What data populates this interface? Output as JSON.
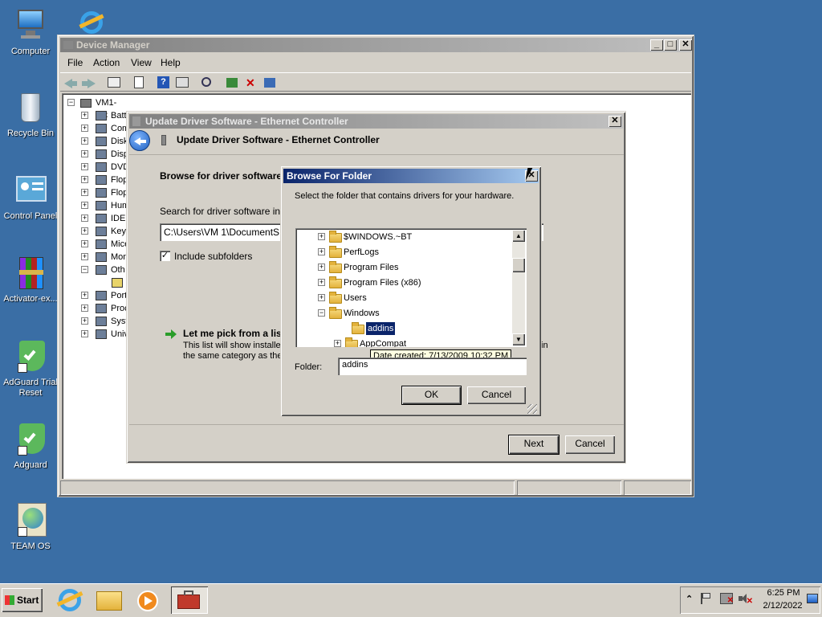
{
  "desktop": {
    "icons": [
      {
        "label": "Computer"
      },
      {
        "label": "Recycle Bin"
      },
      {
        "label": "Control Panel"
      },
      {
        "label": "Activator-ex..."
      },
      {
        "label": "AdGuard Trial Reset"
      },
      {
        "label": "Adguard"
      },
      {
        "label": "TEAM OS"
      }
    ]
  },
  "device_manager": {
    "title": "Device Manager",
    "menu": [
      "File",
      "Action",
      "View",
      "Help"
    ],
    "tree_root": "VM1-PC",
    "tree_items": [
      "Batt",
      "Com",
      "Disk",
      "Disp",
      "DVD",
      "Flop",
      "Flop",
      "Hum",
      "IDE",
      "Key",
      "Mice",
      "Mon",
      "Oth",
      "",
      "Port",
      "Proc",
      "Syst",
      "Univ"
    ]
  },
  "update_driver": {
    "title": "Update Driver Software - Ethernet Controller",
    "header": "Update Driver Software - Ethernet Controller",
    "browse_heading": "Browse for driver software",
    "search_label": "Search for driver software in",
    "path_value": "C:\\Users\\VM 1\\DocumentS",
    "include_subfolders": "Include subfolders",
    "pick_heading": "Let me pick from a lis",
    "pick_desc_1": "This list will show installed",
    "pick_desc_2": "the same category as the",
    "pick_desc_tail": "in",
    "next": "Next",
    "cancel": "Cancel"
  },
  "browse_folder": {
    "title": "Browse For Folder",
    "instruction": "Select the folder that contains drivers for your hardware.",
    "folders": [
      {
        "name": "$WINDOWS.~BT",
        "expander": "+"
      },
      {
        "name": "PerfLogs",
        "expander": "+"
      },
      {
        "name": "Program Files",
        "expander": "+"
      },
      {
        "name": "Program Files (x86)",
        "expander": "+"
      },
      {
        "name": "Users",
        "expander": "+"
      },
      {
        "name": "Windows",
        "expander": "−"
      },
      {
        "name": "addins",
        "expander": ""
      },
      {
        "name": "AppCompat",
        "expander": "+"
      }
    ],
    "tooltip": "Date created: 7/13/2009 10:32 PM",
    "folder_label": "Folder:",
    "folder_value": "addins",
    "ok": "OK",
    "cancel": "Cancel"
  },
  "taskbar": {
    "start": "Start",
    "time": "6:25 PM",
    "date": "2/12/2022"
  }
}
